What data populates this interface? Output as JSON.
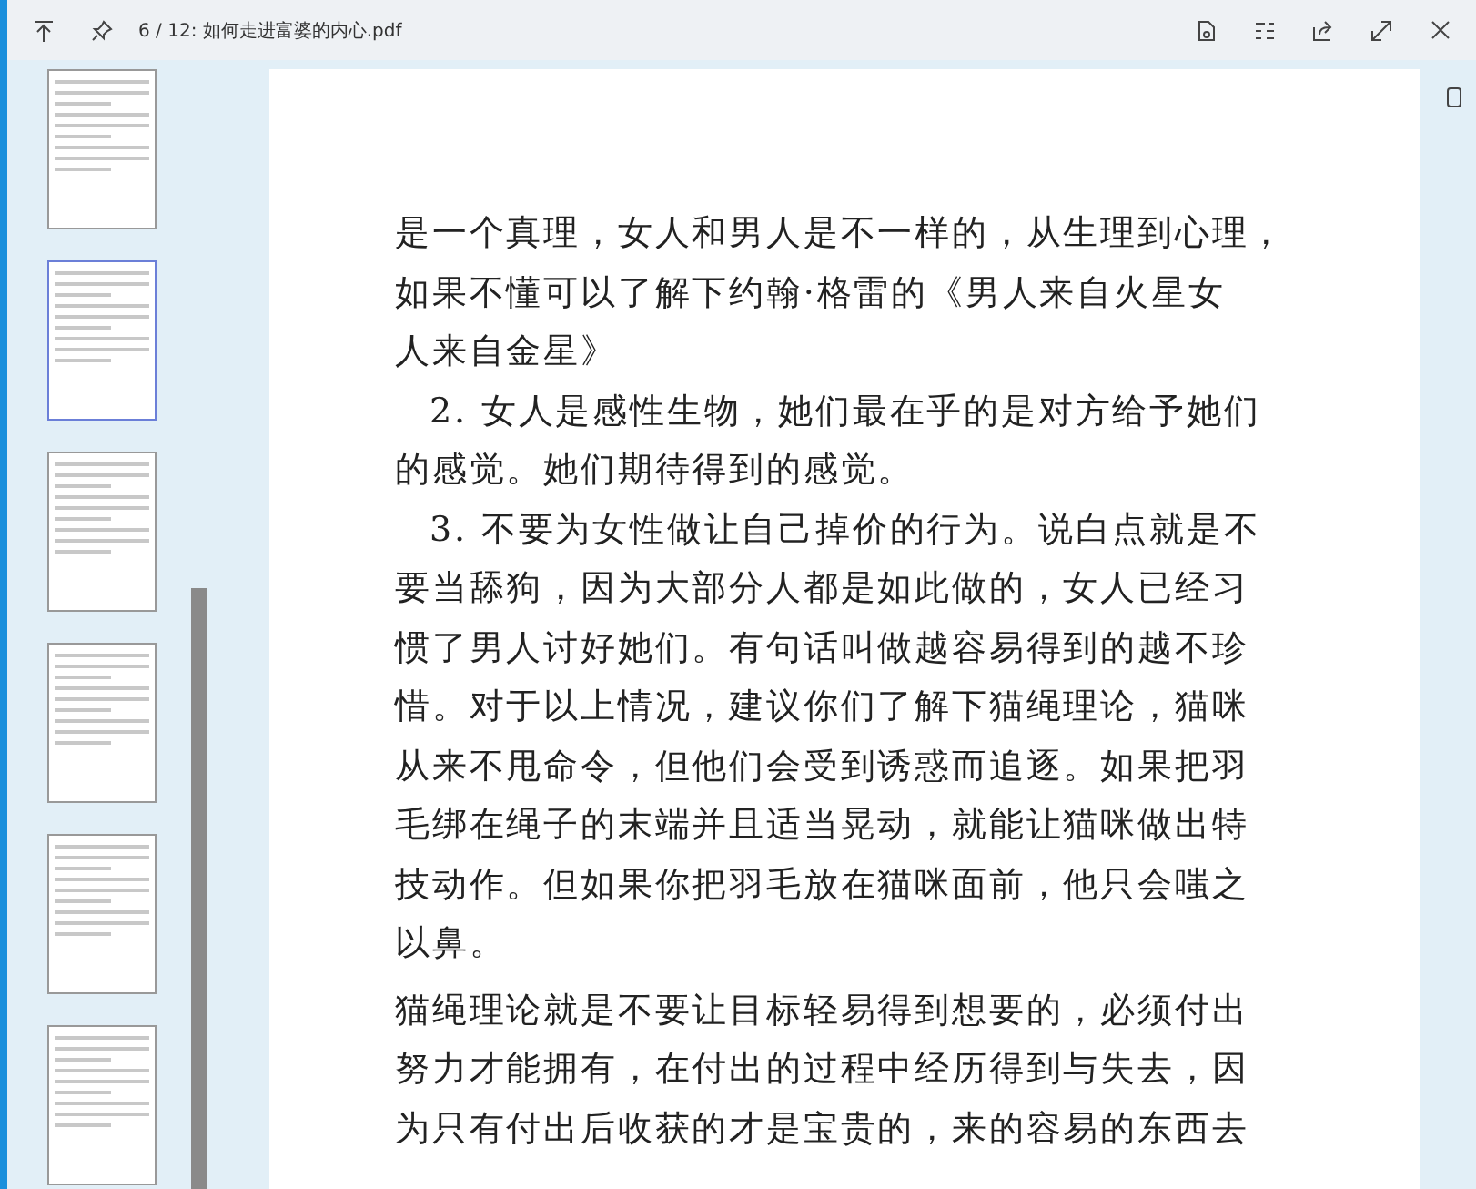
{
  "window": {
    "title": "6 / 12: 如何走进富婆的内心.pdf"
  },
  "thumbnails": [
    {
      "selected": false
    },
    {
      "selected": true
    },
    {
      "selected": false
    },
    {
      "selected": false
    },
    {
      "selected": false
    },
    {
      "selected": false
    }
  ],
  "document": {
    "paragraphs": [
      {
        "indent": false,
        "lines": [
          "是一个真理，女人和男人是不一样的，从生理到心理，",
          "如果不懂可以了解下约翰·格雷的《男人来自火星女",
          "人来自金星》"
        ]
      },
      {
        "indent": true,
        "lines": [
          "2. 女人是感性生物，她们最在乎的是对方给予她们",
          "的感觉。她们期待得到的感觉。"
        ]
      },
      {
        "indent": true,
        "lines": [
          "3. 不要为女性做让自己掉价的行为。说白点就是不",
          "要当舔狗，因为大部分人都是如此做的，女人已经习",
          "惯了男人讨好她们。有句话叫做越容易得到的越不珍",
          "惜。对于以上情况，建议你们了解下猫绳理论，猫咪",
          "从来不甩命令，但他们会受到诱惑而追逐。如果把羽",
          "毛绑在绳子的末端并且适当晃动，就能让猫咪做出特",
          "技动作。但如果你把羽毛放在猫咪面前，他只会嗤之",
          "以鼻。"
        ]
      },
      {
        "indent": false,
        "lines": [
          "猫绳理论就是不要让目标轻易得到想要的，必须付出",
          "努力才能拥有，在付出的过程中经历得到与失去，因",
          "为只有付出后收获的才是宝贵的，来的容易的东西去"
        ]
      }
    ]
  }
}
